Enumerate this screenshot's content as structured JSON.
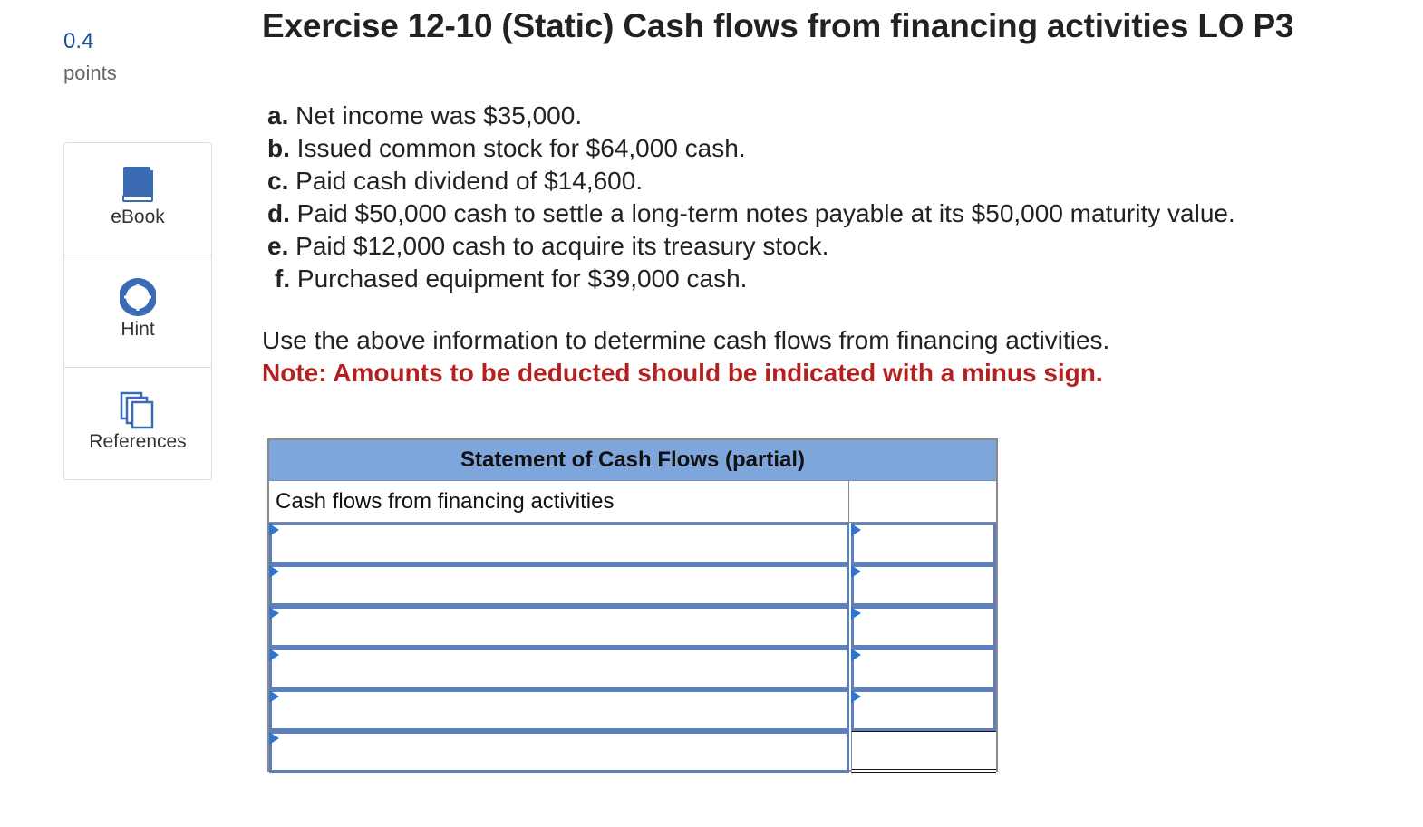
{
  "points": {
    "value": "0.4",
    "label": "points"
  },
  "tools": [
    {
      "label": "eBook",
      "icon": "book-icon"
    },
    {
      "label": "Hint",
      "icon": "lifebuoy-icon"
    },
    {
      "label": "References",
      "icon": "copy-icon"
    }
  ],
  "title": "Exercise 12-10 (Static) Cash flows from financing activities LO P3",
  "items": [
    {
      "letter": "a.",
      "text": " Net income was $35,000."
    },
    {
      "letter": "b.",
      "text": " Issued common stock for $64,000 cash."
    },
    {
      "letter": "c.",
      "text": " Paid cash dividend of $14,600."
    },
    {
      "letter": "d.",
      "text": " Paid $50,000 cash to settle a long-term notes payable at its $50,000 maturity value."
    },
    {
      "letter": "e.",
      "text": " Paid $12,000 cash to acquire its treasury stock."
    },
    {
      "letter": "f.",
      "text": " Purchased equipment for $39,000 cash."
    }
  ],
  "instructions": "Use the above information to determine cash flows from financing activities.",
  "note": "Note: Amounts to be deducted should be indicated with a minus sign.",
  "statement": {
    "header": "Statement of Cash Flows (partial)",
    "section_label": "Cash flows from financing activities",
    "rows": [
      {
        "label": "",
        "amount": ""
      },
      {
        "label": "",
        "amount": ""
      },
      {
        "label": "",
        "amount": ""
      },
      {
        "label": "",
        "amount": ""
      },
      {
        "label": "",
        "amount": ""
      },
      {
        "label": "",
        "amount": ""
      }
    ]
  },
  "colors": {
    "accent": "#1f4e93",
    "note": "#b2201f",
    "header_bg": "#7ea6dc",
    "input_border": "#5e7fb8",
    "marker": "#2f74d0"
  }
}
